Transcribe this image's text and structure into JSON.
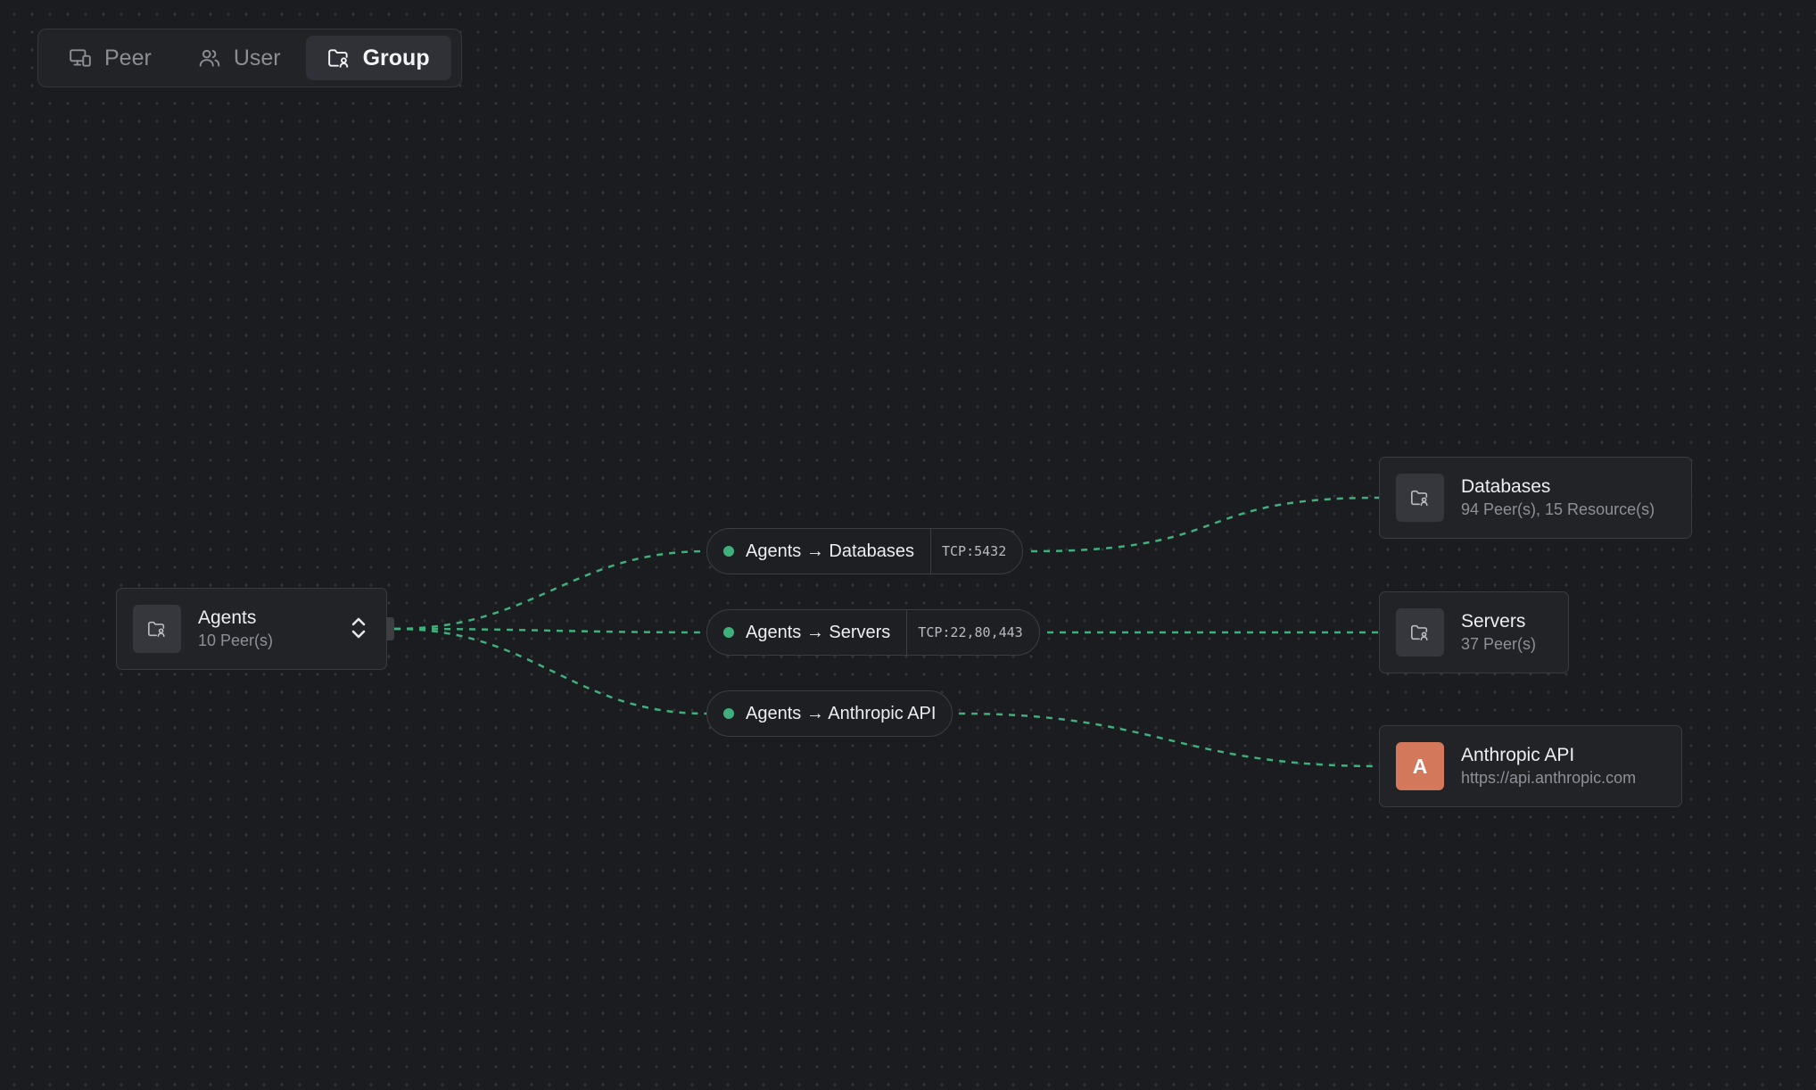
{
  "tabs": [
    {
      "label": "Peer",
      "icon": "monitor-phone-icon"
    },
    {
      "label": "User",
      "icon": "users-icon"
    },
    {
      "label": "Group",
      "icon": "folder-user-icon",
      "active": true
    }
  ],
  "source": {
    "name": "Agents",
    "sub": "10 Peer(s)"
  },
  "policies": [
    {
      "label": "Agents → Databases",
      "ports": "TCP:5432"
    },
    {
      "label": "Agents → Servers",
      "ports": "TCP:22,80,443"
    },
    {
      "label": "Agents → Anthropic API",
      "ports": ""
    }
  ],
  "destinations": [
    {
      "name": "Databases",
      "sub": "94 Peer(s), 15 Resource(s)",
      "icon": "folder-user-icon"
    },
    {
      "name": "Servers",
      "sub": "37 Peer(s)",
      "icon": "folder-user-icon"
    },
    {
      "name": "Anthropic API",
      "sub": "https://api.anthropic.com",
      "letter": "A"
    }
  ],
  "colors": {
    "background": "#1b1c20",
    "edge": "#3fb07c",
    "status_dot": "#3fb07c",
    "anthropic_badge": "#d4785b"
  }
}
